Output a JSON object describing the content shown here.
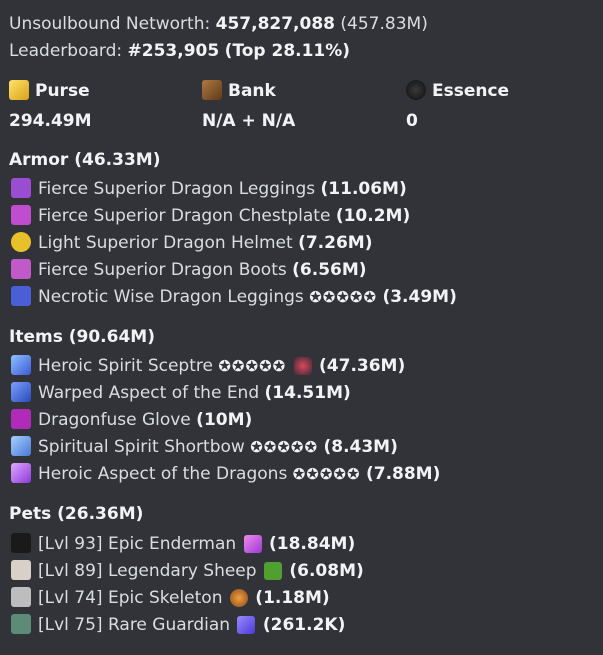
{
  "summary": {
    "networth_label": "Unsoulbound Networth:",
    "networth_value": "457,827,088",
    "networth_short": "(457.83M)",
    "leaderboard_label": "Leaderboard:",
    "leaderboard_rank": "#253,905",
    "leaderboard_top": "(Top 28.11%)"
  },
  "stats": [
    {
      "label": "Purse",
      "value": "294.49M",
      "icon": "gold-ingot-icon",
      "color": "#f5c518"
    },
    {
      "label": "Bank",
      "value": "N/A + N/A",
      "icon": "chest-icon",
      "color": "#8b5a2b"
    },
    {
      "label": "Essence",
      "value": "0",
      "icon": "essence-icon",
      "color": "#1a1a1a"
    }
  ],
  "armor": {
    "title": "Armor (46.33M)",
    "items": [
      {
        "name": "Fierce Superior Dragon Leggings",
        "value": "(11.06M)",
        "color": "#9b4dd1",
        "stars": ""
      },
      {
        "name": "Fierce Superior Dragon Chestplate",
        "value": "(10.2M)",
        "color": "#c04ccf",
        "stars": ""
      },
      {
        "name": "Light Superior Dragon Helmet",
        "value": "(7.26M)",
        "color": "#e8c12a",
        "stars": ""
      },
      {
        "name": "Fierce Superior Dragon Boots",
        "value": "(6.56M)",
        "color": "#c05ac8",
        "stars": ""
      },
      {
        "name": "Necrotic Wise Dragon Leggings",
        "value": "(3.49M)",
        "color": "#4a5fd6",
        "stars": "✪✪✪✪✪"
      }
    ]
  },
  "items": {
    "title": "Items (90.64M)",
    "entries": [
      {
        "name": "Heroic Spirit Sceptre",
        "value": "(47.36M)",
        "color": "#6fa0e8",
        "stars": "✪✪✪✪✪",
        "extra_icon": true
      },
      {
        "name": "Warped Aspect of the End",
        "value": "(14.51M)",
        "color": "#5b7ee8",
        "stars": ""
      },
      {
        "name": "Dragonfuse Glove",
        "value": "(10M)",
        "color": "#b02bb8",
        "stars": ""
      },
      {
        "name": "Spiritual Spirit Shortbow",
        "value": "(8.43M)",
        "color": "#7aa6e8",
        "stars": "✪✪✪✪✪"
      },
      {
        "name": "Heroic Aspect of the Dragons",
        "value": "(7.88M)",
        "color": "#c87ee8",
        "stars": "✪✪✪✪✪"
      }
    ]
  },
  "pets": {
    "title": "Pets (26.36M)",
    "entries": [
      {
        "name": "[Lvl 93] Epic Enderman",
        "value": "(18.84M)",
        "color": "#1a1a1a",
        "held_color": "#d94fd6"
      },
      {
        "name": "[Lvl 89] Legendary Sheep",
        "value": "(6.08M)",
        "color": "#d9d0c7",
        "held_color": "#4fa02e"
      },
      {
        "name": "[Lvl 74] Epic Skeleton",
        "value": "(1.18M)",
        "color": "#bdbdbd",
        "held_color": "#d9862b"
      },
      {
        "name": "[Lvl 75] Rare Guardian",
        "value": "(261.2K)",
        "color": "#5e8a78",
        "held_color": "#6a5ae0"
      }
    ]
  }
}
